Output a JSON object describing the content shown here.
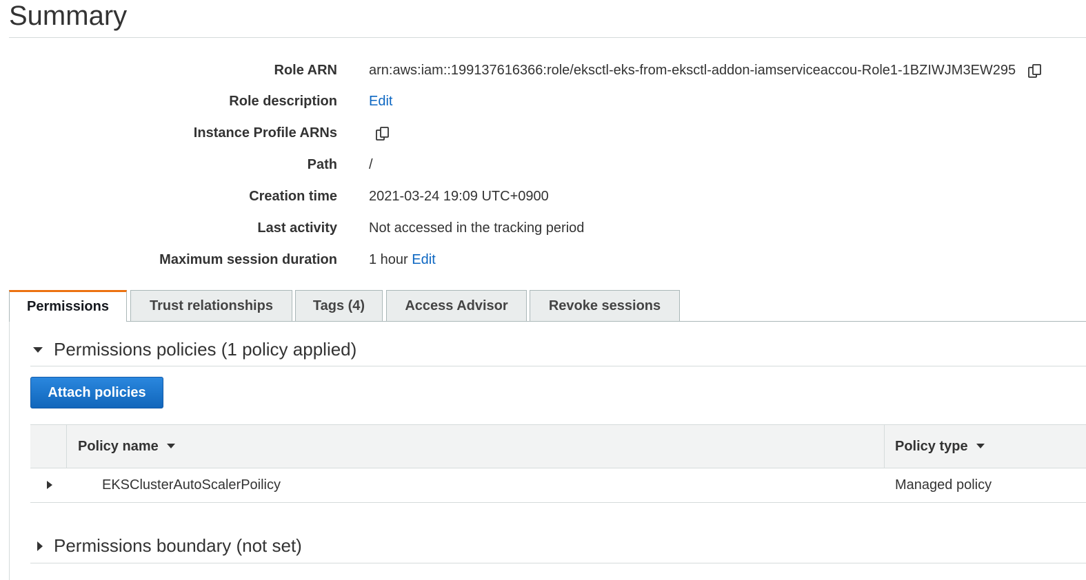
{
  "summary": {
    "title": "Summary",
    "rows": [
      {
        "label": "Role ARN",
        "value": "arn:aws:iam::199137616366:role/eksctl-eks-from-eksctl-addon-iamserviceaccou-Role1-1BZIWJM3EW295"
      },
      {
        "label": "Role description",
        "link": "Edit"
      },
      {
        "label": "Instance Profile ARNs"
      },
      {
        "label": "Path",
        "value": "/"
      },
      {
        "label": "Creation time",
        "value": "2021-03-24 19:09 UTC+0900"
      },
      {
        "label": "Last activity",
        "value": "Not accessed in the tracking period"
      },
      {
        "label": "Maximum session duration",
        "value": "1 hour",
        "link": "Edit"
      }
    ]
  },
  "tabs": [
    {
      "label": "Permissions",
      "active": true
    },
    {
      "label": "Trust relationships"
    },
    {
      "label": "Tags (4)"
    },
    {
      "label": "Access Advisor"
    },
    {
      "label": "Revoke sessions"
    }
  ],
  "permissions": {
    "policies_heading": "Permissions policies (1 policy applied)",
    "attach_button": "Attach policies",
    "table": {
      "columns": [
        "Policy name",
        "Policy type"
      ],
      "rows": [
        {
          "name": "EKSClusterAutoScalerPoilicy",
          "type": "Managed policy"
        }
      ]
    },
    "boundary_heading": "Permissions boundary (not set)"
  },
  "colors": {
    "link": "#0b66c2",
    "active_tab": "#ec7211",
    "primary_button": "#1166bb"
  },
  "icons": [
    "copy-icon",
    "caret-down-icon",
    "caret-right-icon",
    "sort-caret-icon"
  ]
}
